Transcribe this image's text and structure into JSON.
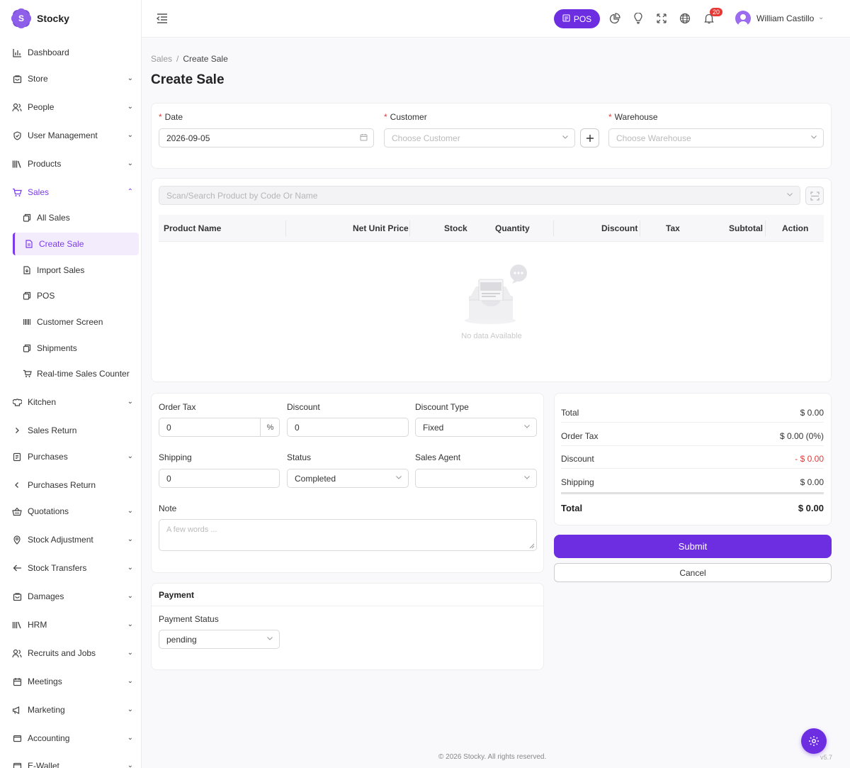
{
  "app": {
    "name": "Stocky",
    "logo_letter": "S",
    "accent_color": "#6c2ee0"
  },
  "sidebar": {
    "items": [
      {
        "label": "Dashboard",
        "icon": "bar-chart-icon"
      },
      {
        "label": "Store",
        "icon": "store-icon"
      },
      {
        "label": "People",
        "icon": "people-icon"
      },
      {
        "label": "User Management",
        "icon": "shield-icon"
      },
      {
        "label": "Products",
        "icon": "books-icon"
      },
      {
        "label": "Sales",
        "icon": "cart-icon"
      },
      {
        "label": "Kitchen",
        "icon": "chef-hat-icon"
      },
      {
        "label": "Sales Return",
        "icon": "chevron-right-icon"
      },
      {
        "label": "Purchases",
        "icon": "receipt-icon"
      },
      {
        "label": "Purchases Return",
        "icon": "chevron-left-icon"
      },
      {
        "label": "Quotations",
        "icon": "basket-icon"
      },
      {
        "label": "Stock Adjustment",
        "icon": "location-pin-icon"
      },
      {
        "label": "Stock Transfers",
        "icon": "arrow-left-icon"
      },
      {
        "label": "Damages",
        "icon": "store-icon"
      },
      {
        "label": "HRM",
        "icon": "library-icon"
      },
      {
        "label": "Recruits and Jobs",
        "icon": "people-icon"
      },
      {
        "label": "Meetings",
        "icon": "calendar-icon"
      },
      {
        "label": "Marketing",
        "icon": "megaphone-icon"
      },
      {
        "label": "Accounting",
        "icon": "wallet-icon"
      },
      {
        "label": "E-Wallet",
        "icon": "wallet-icon"
      }
    ],
    "sales_sub": [
      {
        "label": "All Sales",
        "icon": "copy-icon"
      },
      {
        "label": "Create Sale",
        "icon": "document-icon"
      },
      {
        "label": "Import Sales",
        "icon": "import-icon"
      },
      {
        "label": "POS",
        "icon": "copy-icon"
      },
      {
        "label": "Customer Screen",
        "icon": "barcode-icon"
      },
      {
        "label": "Shipments",
        "icon": "copy-icon"
      },
      {
        "label": "Real-time Sales Counter",
        "icon": "cart-icon"
      }
    ]
  },
  "topbar": {
    "pos_label": "POS",
    "notification_count": "20",
    "user_name": "William Castillo"
  },
  "breadcrumb": {
    "parent": "Sales",
    "separator": "/",
    "current": "Create Sale"
  },
  "page_title": "Create Sale",
  "form": {
    "date_label": "Date",
    "date_value": "2026-09-05",
    "customer_label": "Customer",
    "customer_placeholder": "Choose Customer",
    "warehouse_label": "Warehouse",
    "warehouse_placeholder": "Choose Warehouse",
    "required_mark": "*"
  },
  "products": {
    "search_placeholder": "Scan/Search Product by Code Or Name",
    "columns": [
      "Product Name",
      "Net Unit Price",
      "Stock",
      "Quantity",
      "Discount",
      "Tax",
      "Subtotal",
      "Action"
    ],
    "empty_text": "No data Available"
  },
  "details": {
    "order_tax_label": "Order Tax",
    "order_tax_value": "0",
    "order_tax_suffix": "%",
    "discount_label": "Discount",
    "discount_value": "0",
    "discount_type_label": "Discount Type",
    "discount_type_value": "Fixed",
    "shipping_label": "Shipping",
    "shipping_value": "0",
    "status_label": "Status",
    "status_value": "Completed",
    "sales_agent_label": "Sales Agent",
    "sales_agent_value": "",
    "note_label": "Note",
    "note_placeholder": "A few words ..."
  },
  "payment": {
    "header": "Payment",
    "status_label": "Payment Status",
    "status_value": "pending"
  },
  "summary": {
    "rows": [
      {
        "label": "Total",
        "value": "$ 0.00"
      },
      {
        "label": "Order Tax",
        "value": "$ 0.00 (0%)"
      },
      {
        "label": "Discount",
        "value": "- $ 0.00"
      },
      {
        "label": "Shipping",
        "value": "$ 0.00"
      }
    ],
    "total_label": "Total",
    "total_value": "$ 0.00"
  },
  "actions": {
    "submit": "Submit",
    "cancel": "Cancel"
  },
  "footer": {
    "copyright": "© 2026 Stocky. All rights reserved.",
    "version": "v5.7"
  }
}
